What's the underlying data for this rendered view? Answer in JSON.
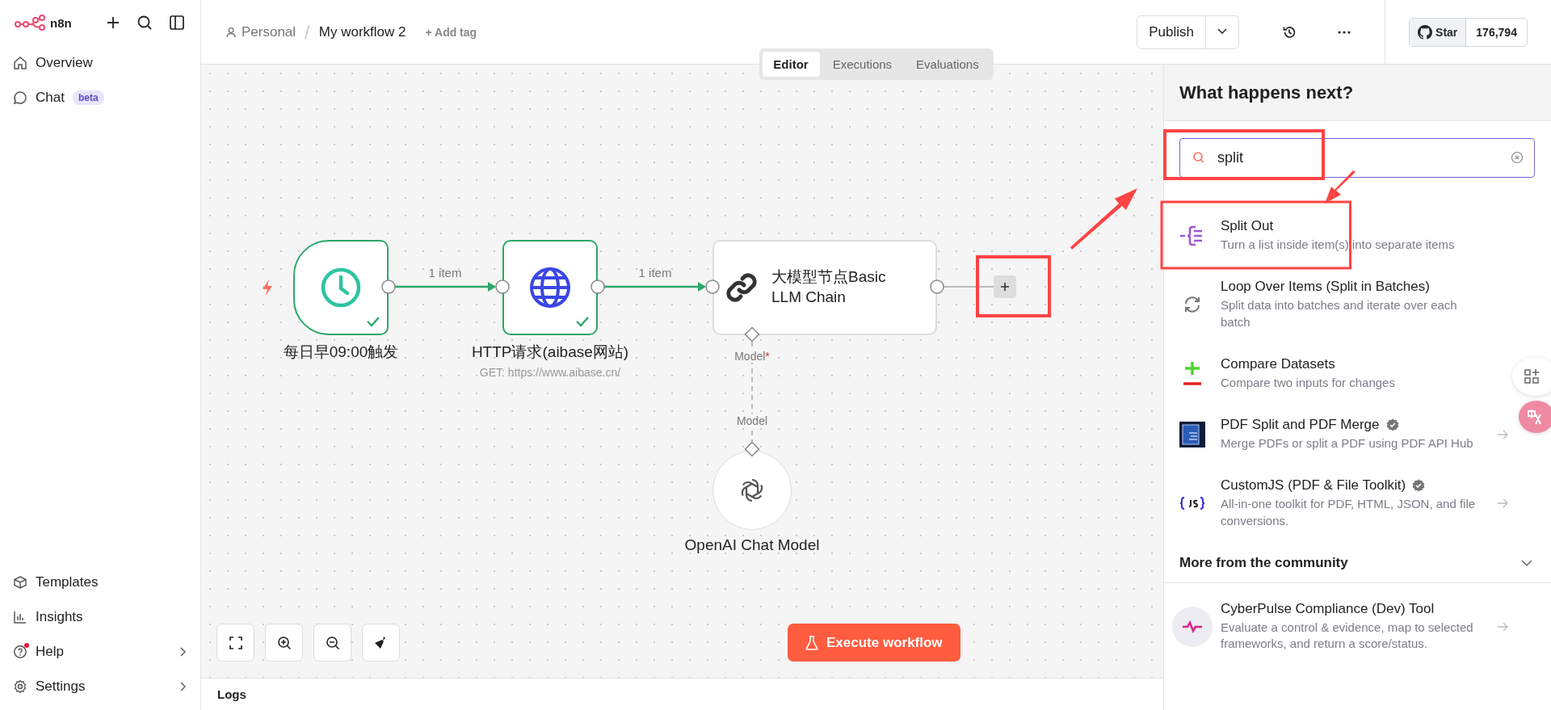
{
  "sidebar": {
    "brand": "n8n",
    "top_items": [
      {
        "label": "Overview",
        "kind": "home"
      },
      {
        "label": "Chat",
        "kind": "chat",
        "badge": "beta"
      }
    ],
    "bottom_items": [
      {
        "label": "Templates",
        "kind": "templates",
        "expandable": false,
        "notification": false
      },
      {
        "label": "Insights",
        "kind": "insights",
        "expandable": false,
        "notification": false
      },
      {
        "label": "Help",
        "kind": "help",
        "expandable": true,
        "notification": true
      },
      {
        "label": "Settings",
        "kind": "settings",
        "expandable": true,
        "notification": false
      }
    ]
  },
  "header": {
    "project": "Personal",
    "separator": "/",
    "workflow": "My workflow 2",
    "add_tag": "+ Add tag",
    "publish_button": "Publish",
    "github": {
      "label": "Star",
      "count": "176,794"
    }
  },
  "canvas": {
    "tabs": [
      {
        "label": "Editor",
        "selected": true
      },
      {
        "label": "Executions",
        "selected": false
      },
      {
        "label": "Evaluations",
        "selected": false
      }
    ],
    "nodes": [
      {
        "kind": "schedule",
        "label": "每日早09:00触发",
        "success": true
      },
      {
        "kind": "http",
        "label": "HTTP请求(aibase网站)",
        "subtitle": "GET: https://www.aibase.cn/",
        "success": true
      },
      {
        "kind": "chain",
        "label": "大模型节点Basic LLM Chain",
        "success": false
      },
      {
        "kind": "model",
        "label": "OpenAI Chat Model"
      }
    ],
    "edges": [
      {
        "label": "1 item",
        "success": true
      },
      {
        "label": "1 item",
        "success": true
      }
    ],
    "sub_connection": {
      "from_label": "Model",
      "from_marker": "*",
      "to_label": "Model"
    },
    "execute_button": "Execute workflow"
  },
  "logs": {
    "title": "Logs"
  },
  "panel": {
    "title": "What happens next?",
    "search": {
      "value": "split"
    },
    "results": [
      {
        "kind": "split",
        "name": "Split Out",
        "description": "Turn a list inside item(s) into separate items",
        "verified": false,
        "details_arrow": false
      },
      {
        "kind": "loop",
        "name": "Loop Over Items (Split in Batches)",
        "description": "Split data into batches and iterate over each batch",
        "verified": false,
        "details_arrow": false
      },
      {
        "kind": "compare",
        "name": "Compare Datasets",
        "description": "Compare two inputs for changes",
        "verified": false,
        "details_arrow": false
      },
      {
        "kind": "pdf",
        "name": "PDF Split and PDF Merge",
        "description": "Merge PDFs or split a PDF using PDF API Hub",
        "verified": true,
        "details_arrow": true
      },
      {
        "kind": "js",
        "name": "CustomJS (PDF & File Toolkit)",
        "description": "All-in-one toolkit for PDF, HTML, JSON, and file conversions.",
        "verified": true,
        "details_arrow": true
      }
    ],
    "community": {
      "title": "More from the community",
      "expanded": true,
      "results": [
        {
          "kind": "pulse",
          "name": "CyberPulse Compliance (Dev) Tool",
          "description": "Evaluate a control & evidence, map to selected frameworks, and return a score/status.",
          "verified": false,
          "details_arrow": true
        }
      ]
    }
  }
}
